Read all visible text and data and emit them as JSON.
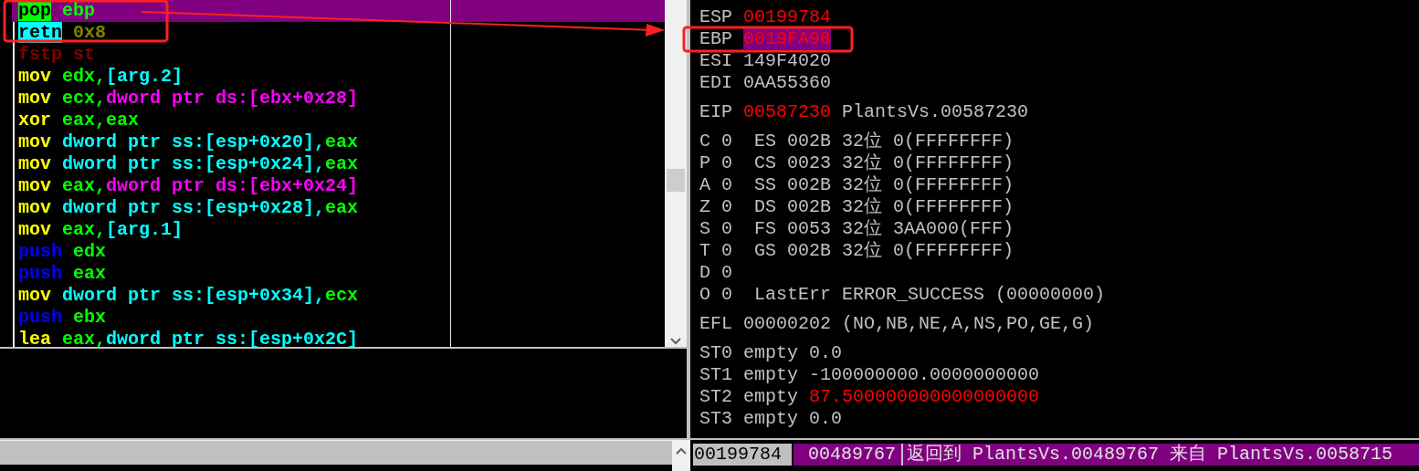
{
  "disassembly": {
    "lines": [
      {
        "selected": true,
        "tokens": [
          {
            "text": "pop",
            "kind": "pop"
          },
          {
            "text": " ebp",
            "kind": "reg"
          }
        ]
      },
      {
        "selected": false,
        "tokens": [
          {
            "text": "retn",
            "kind": "ret"
          },
          {
            "text": " 0x8",
            "kind": "imm"
          }
        ]
      },
      {
        "selected": false,
        "tokens": [
          {
            "text": "fstp st",
            "kind": "fpu"
          }
        ]
      },
      {
        "selected": false,
        "tokens": [
          {
            "text": "mov",
            "kind": "op"
          },
          {
            "text": " edx,",
            "kind": "reg"
          },
          {
            "text": "[arg.2]",
            "kind": "mem"
          }
        ]
      },
      {
        "selected": false,
        "tokens": [
          {
            "text": "mov",
            "kind": "op"
          },
          {
            "text": " ecx,",
            "kind": "reg"
          },
          {
            "text": "dword ptr ds:[ebx+0x28]",
            "kind": "dsmem"
          }
        ]
      },
      {
        "selected": false,
        "tokens": [
          {
            "text": "xor",
            "kind": "op"
          },
          {
            "text": " eax,eax",
            "kind": "reg"
          }
        ]
      },
      {
        "selected": false,
        "tokens": [
          {
            "text": "mov",
            "kind": "op"
          },
          {
            "text": " dword ptr ss:[esp+0x20],",
            "kind": "mem"
          },
          {
            "text": "eax",
            "kind": "reg"
          }
        ]
      },
      {
        "selected": false,
        "tokens": [
          {
            "text": "mov",
            "kind": "op"
          },
          {
            "text": " dword ptr ss:[esp+0x24],",
            "kind": "mem"
          },
          {
            "text": "eax",
            "kind": "reg"
          }
        ]
      },
      {
        "selected": false,
        "tokens": [
          {
            "text": "mov",
            "kind": "op"
          },
          {
            "text": " eax,",
            "kind": "reg"
          },
          {
            "text": "dword ptr ds:[ebx+0x24]",
            "kind": "dsmem"
          }
        ]
      },
      {
        "selected": false,
        "tokens": [
          {
            "text": "mov",
            "kind": "op"
          },
          {
            "text": " dword ptr ss:[esp+0x28],",
            "kind": "mem"
          },
          {
            "text": "eax",
            "kind": "reg"
          }
        ]
      },
      {
        "selected": false,
        "tokens": [
          {
            "text": "mov",
            "kind": "op"
          },
          {
            "text": " eax,",
            "kind": "reg"
          },
          {
            "text": "[arg.1]",
            "kind": "mem"
          }
        ]
      },
      {
        "selected": false,
        "tokens": [
          {
            "text": "push",
            "kind": "push"
          },
          {
            "text": " edx",
            "kind": "reg"
          }
        ]
      },
      {
        "selected": false,
        "tokens": [
          {
            "text": "push",
            "kind": "push"
          },
          {
            "text": " eax",
            "kind": "reg"
          }
        ]
      },
      {
        "selected": false,
        "tokens": [
          {
            "text": "mov",
            "kind": "op"
          },
          {
            "text": " dword ptr ss:[esp+0x34],",
            "kind": "mem"
          },
          {
            "text": "ecx",
            "kind": "reg"
          }
        ]
      },
      {
        "selected": false,
        "tokens": [
          {
            "text": "push",
            "kind": "push"
          },
          {
            "text": " ebx",
            "kind": "reg"
          }
        ]
      },
      {
        "selected": false,
        "tokens": [
          {
            "text": "lea",
            "kind": "op"
          },
          {
            "text": " eax,",
            "kind": "reg"
          },
          {
            "text": "dword ptr ss:[esp+0x2C]",
            "kind": "mem"
          }
        ]
      }
    ]
  },
  "registers": {
    "groups": [
      [
        {
          "tokens": [
            {
              "text": "ESP ",
              "kind": "plain"
            },
            {
              "text": "00199784",
              "kind": "changed"
            }
          ]
        },
        {
          "tokens": [
            {
              "text": "EBP ",
              "kind": "plain"
            },
            {
              "text": "0019FA98",
              "kind": "changed-marked"
            }
          ]
        },
        {
          "tokens": [
            {
              "text": "ESI 149F4020",
              "kind": "plain"
            }
          ]
        },
        {
          "tokens": [
            {
              "text": "EDI 0AA55360",
              "kind": "plain"
            }
          ]
        }
      ],
      [
        {
          "tokens": [
            {
              "text": "EIP ",
              "kind": "plain"
            },
            {
              "text": "00587230",
              "kind": "changed"
            },
            {
              "text": " PlantsVs.00587230",
              "kind": "plain"
            }
          ]
        }
      ],
      [
        {
          "tokens": [
            {
              "text": "C 0  ES 002B 32位 0(FFFFFFFF)",
              "kind": "plain"
            }
          ]
        },
        {
          "tokens": [
            {
              "text": "P 0  CS 0023 32位 0(FFFFFFFF)",
              "kind": "plain"
            }
          ]
        },
        {
          "tokens": [
            {
              "text": "A 0  SS 002B 32位 0(FFFFFFFF)",
              "kind": "plain"
            }
          ]
        },
        {
          "tokens": [
            {
              "text": "Z 0  DS 002B 32位 0(FFFFFFFF)",
              "kind": "plain"
            }
          ]
        },
        {
          "tokens": [
            {
              "text": "S 0  FS 0053 32位 3AA000(FFF)",
              "kind": "plain"
            }
          ]
        },
        {
          "tokens": [
            {
              "text": "T 0  GS 002B 32位 0(FFFFFFFF)",
              "kind": "plain"
            }
          ]
        },
        {
          "tokens": [
            {
              "text": "D 0",
              "kind": "plain"
            }
          ]
        },
        {
          "tokens": [
            {
              "text": "O 0  LastErr ERROR_SUCCESS (00000000)",
              "kind": "plain"
            }
          ]
        }
      ],
      [
        {
          "tokens": [
            {
              "text": "EFL 00000202 (NO,NB,NE,A,NS,PO,GE,G)",
              "kind": "plain"
            }
          ]
        }
      ],
      [
        {
          "tokens": [
            {
              "text": "ST0 empty 0.0",
              "kind": "plain"
            }
          ]
        },
        {
          "tokens": [
            {
              "text": "ST1 empty -100000000.0000000000",
              "kind": "plain"
            }
          ]
        },
        {
          "tokens": [
            {
              "text": "ST2 empty ",
              "kind": "plain"
            },
            {
              "text": "87.500000000000000000",
              "kind": "changed"
            }
          ]
        },
        {
          "tokens": [
            {
              "text": "ST3 empty 0.0",
              "kind": "plain"
            }
          ]
        }
      ]
    ]
  },
  "stack": {
    "rows": [
      {
        "selected": true,
        "address": "00199784",
        "value": "00489767",
        "comment": "返回到 PlantsVs.00489767 来自 PlantsVs.0058715"
      }
    ]
  }
}
